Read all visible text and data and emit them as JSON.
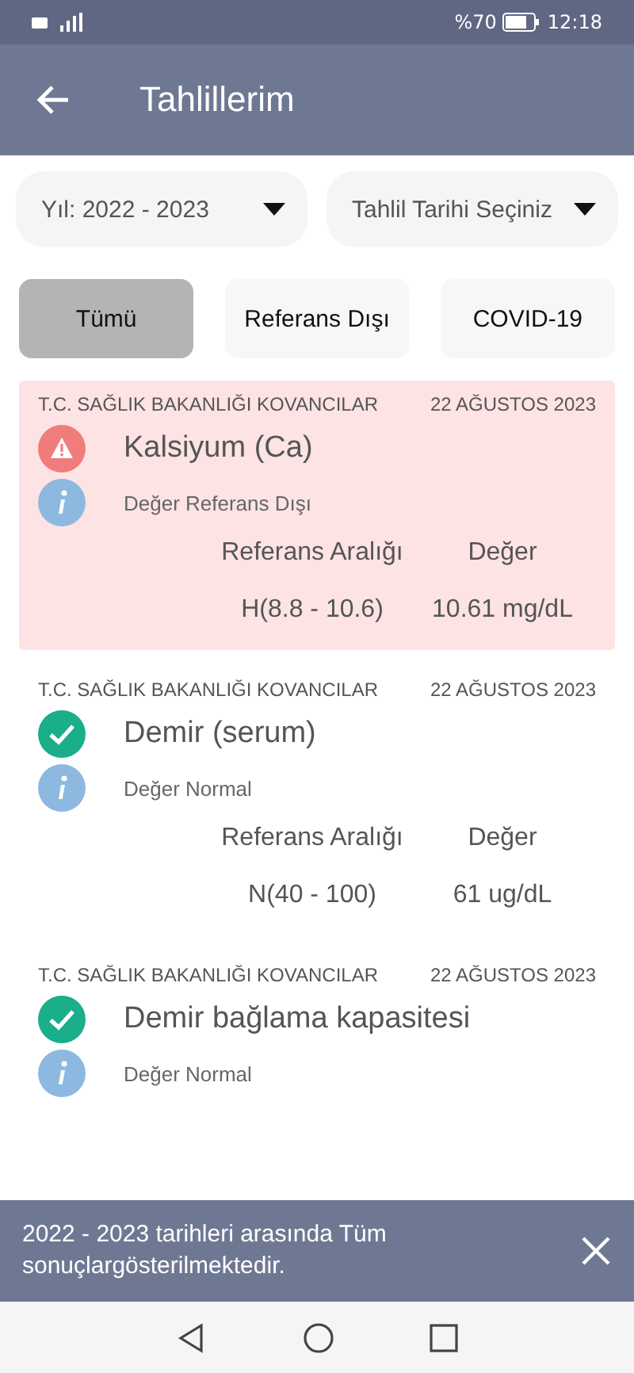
{
  "status_bar": {
    "battery_text": "%70",
    "time": "12:18"
  },
  "app_bar": {
    "title": "Tahlillerim"
  },
  "filters": [
    {
      "value": "Yıl: 2022 - 2023"
    },
    {
      "value": "Tahlil Tarihi Seçiniz"
    }
  ],
  "tabs": [
    {
      "label": "Tümü",
      "selected": true
    },
    {
      "label": "Referans Dışı",
      "selected": false
    },
    {
      "label": "COVID-19",
      "selected": false
    }
  ],
  "results": [
    {
      "kind": "out_of_range",
      "institution": "T.C. SAĞLIK BAKANLIĞI KOVANCILAR",
      "date": "22 AĞUSTOS 2023",
      "name": "Kalsiyum (Ca)",
      "status": "Değer Referans Dışı",
      "range_heading": "Referans Aralığı",
      "value_heading": "Değer",
      "range": "H(8.8 - 10.6)",
      "value": "10.61 mg/dL"
    },
    {
      "kind": "normal",
      "institution": "T.C. SAĞLIK BAKANLIĞI KOVANCILAR",
      "date": "22 AĞUSTOS 2023",
      "name": "Demir (serum)",
      "status": "Değer Normal",
      "range_heading": "Referans Aralığı",
      "value_heading": "Değer",
      "range": "N(40 - 100)",
      "value": "61 ug/dL"
    },
    {
      "kind": "normal",
      "institution": "T.C. SAĞLIK BAKANLIĞI KOVANCILAR",
      "date": "22 AĞUSTOS 2023",
      "name": "Demir bağlama kapasitesi",
      "status": "Değer Normal"
    }
  ],
  "snackbar": {
    "message": "2022 - 2023 tarihleri arasında Tüm sonuçlargösterilmektedir."
  }
}
